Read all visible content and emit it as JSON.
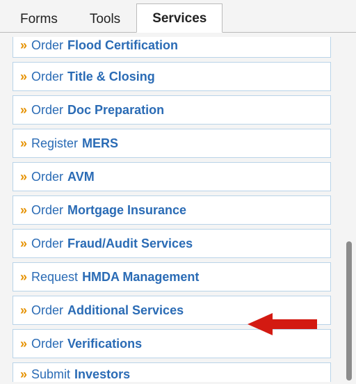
{
  "tabs": [
    {
      "label": "Forms",
      "active": false
    },
    {
      "label": "Tools",
      "active": false
    },
    {
      "label": "Services",
      "active": true
    }
  ],
  "items": [
    {
      "pre": "Order",
      "bold": "Flood Certification",
      "cut": "top"
    },
    {
      "pre": "Order",
      "bold": "Title & Closing"
    },
    {
      "pre": "Order",
      "bold": "Doc Preparation"
    },
    {
      "pre": "Register",
      "bold": "MERS"
    },
    {
      "pre": "Order",
      "bold": "AVM"
    },
    {
      "pre": "Order",
      "bold": "Mortgage Insurance"
    },
    {
      "pre": "Order",
      "bold": "Fraud/Audit Services"
    },
    {
      "pre": "Request",
      "bold": "HMDA Management"
    },
    {
      "pre": "Order",
      "bold": "Additional Services",
      "annotated": true
    },
    {
      "pre": "Order",
      "bold": "Verifications"
    },
    {
      "pre": "Submit",
      "bold": "Investors",
      "cut": "bot"
    }
  ],
  "icon": {
    "chevron": "»"
  }
}
